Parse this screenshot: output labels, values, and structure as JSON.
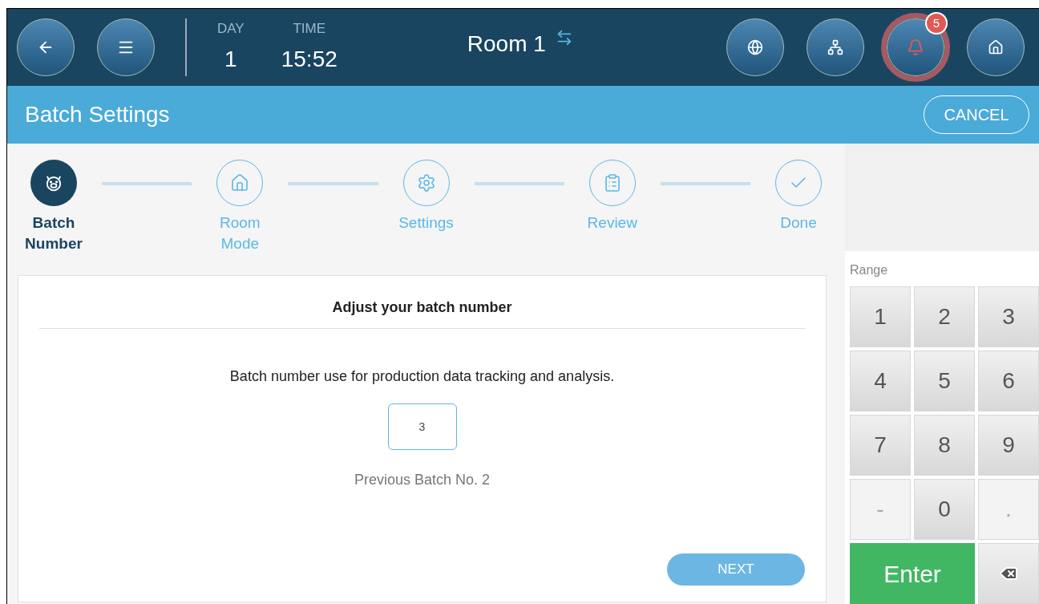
{
  "top_bar": {
    "day_label": "DAY",
    "day": "1",
    "time_label": "TIME",
    "time": "15:52",
    "room": "Room 1",
    "alarm_count": "5",
    "alarm_active": true
  },
  "header": {
    "title": "Batch Settings",
    "cancel": "CANCEL"
  },
  "steps": [
    {
      "label": "Batch Number",
      "kind": "pig",
      "selected": true
    },
    {
      "label": "Room Mode",
      "kind": "house",
      "selected": false
    },
    {
      "label": "Settings",
      "kind": "gear",
      "selected": false
    },
    {
      "label": "Review",
      "kind": "clipboard",
      "selected": false
    },
    {
      "label": "Done",
      "kind": "check",
      "selected": false
    }
  ],
  "card": {
    "title": "Adjust your batch number",
    "description": "Batch number use for production data tracking and analysis.",
    "value": "3",
    "previous": "Previous Batch No. 2",
    "next": "NEXT"
  },
  "keypad": {
    "range_label": "Range",
    "keys": [
      {
        "kind": "digit",
        "label": "1",
        "disabled": false
      },
      {
        "kind": "digit",
        "label": "2",
        "disabled": false
      },
      {
        "kind": "digit",
        "label": "3",
        "disabled": false
      },
      {
        "kind": "digit",
        "label": "4",
        "disabled": false
      },
      {
        "kind": "digit",
        "label": "5",
        "disabled": false
      },
      {
        "kind": "digit",
        "label": "6",
        "disabled": false
      },
      {
        "kind": "digit",
        "label": "7",
        "disabled": false
      },
      {
        "kind": "digit",
        "label": "8",
        "disabled": false
      },
      {
        "kind": "digit",
        "label": "9",
        "disabled": false
      },
      {
        "kind": "digit",
        "label": "-",
        "disabled": true
      },
      {
        "kind": "digit",
        "label": "0",
        "disabled": false
      },
      {
        "kind": "digit",
        "label": ".",
        "disabled": true
      },
      {
        "kind": "enter",
        "label": "Enter",
        "disabled": false
      },
      {
        "kind": "backspace"
      }
    ]
  }
}
